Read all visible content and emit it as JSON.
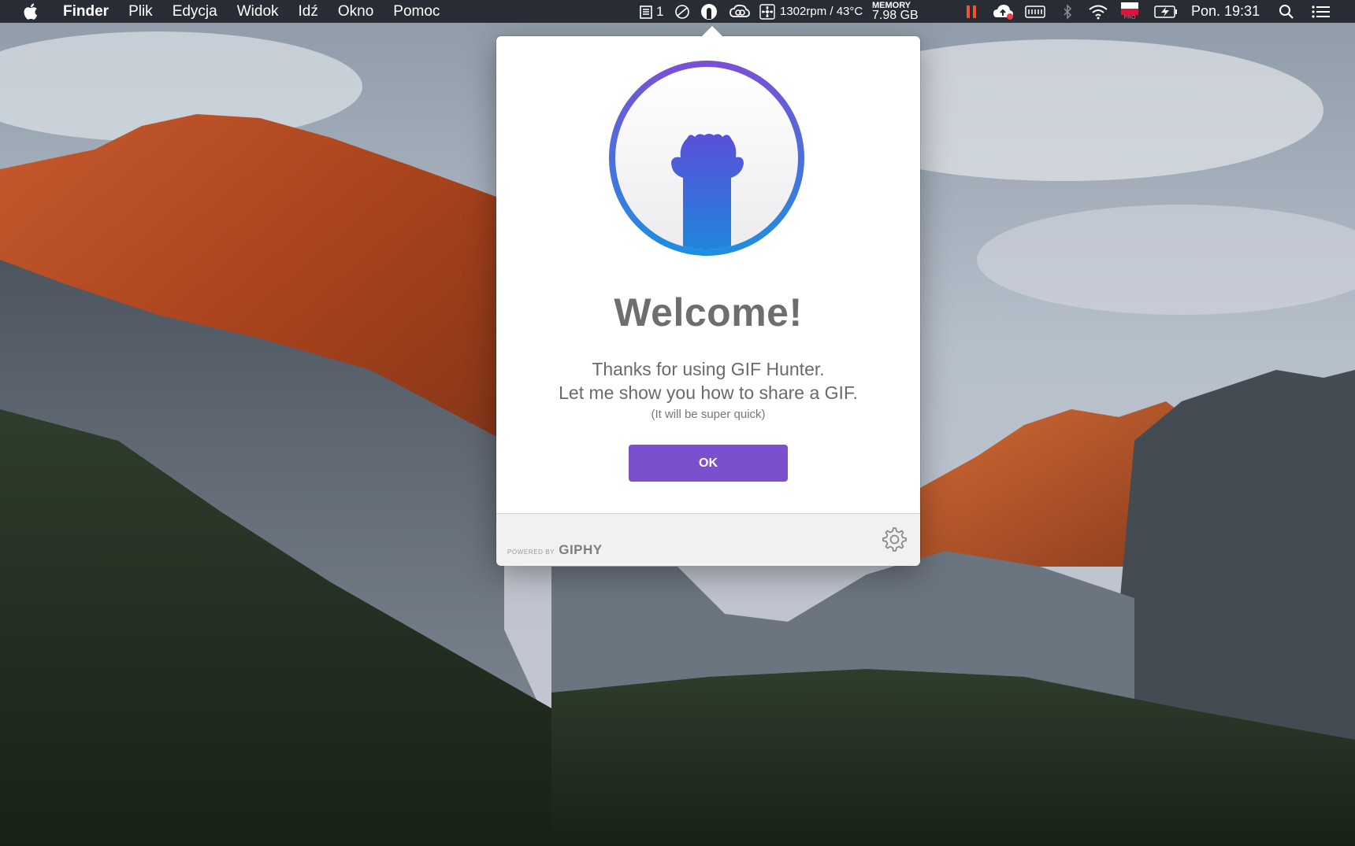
{
  "menubar": {
    "app_name": "Finder",
    "menus": [
      "Plik",
      "Edycja",
      "Widok",
      "Idź",
      "Okno",
      "Pomoc"
    ],
    "status": {
      "stack_count": "1",
      "fan_temp": "1302rpm / 43°C",
      "memory_label": "MEMORY",
      "memory_value": "7.98 GB",
      "flag_badge": "PRO",
      "clock": "Pon. 19:31"
    },
    "icons": [
      "apple-icon",
      "stack-icon",
      "do-not-disturb-icon",
      "gif-hunter-icon",
      "creative-cloud-icon",
      "fan-icon",
      "pause-icon",
      "cloud-upload-icon",
      "keyboard-icon",
      "bluetooth-icon",
      "wifi-icon",
      "flag-poland-icon",
      "battery-icon",
      "search-icon",
      "notification-center-icon"
    ]
  },
  "popover": {
    "title": "Welcome!",
    "line1": "Thanks for using GIF Hunter.",
    "line2": "Let me show you how to share a GIF.",
    "line3": "(It will be super quick)",
    "ok_label": "OK",
    "powered_by": "POWERED BY",
    "brand": "GIPHY"
  },
  "colors": {
    "accent": "#7b50cf",
    "logo_gradient_top": "#7a4fd6",
    "logo_gradient_bottom": "#1d8fe0",
    "menubar_bg": "#20242c"
  }
}
